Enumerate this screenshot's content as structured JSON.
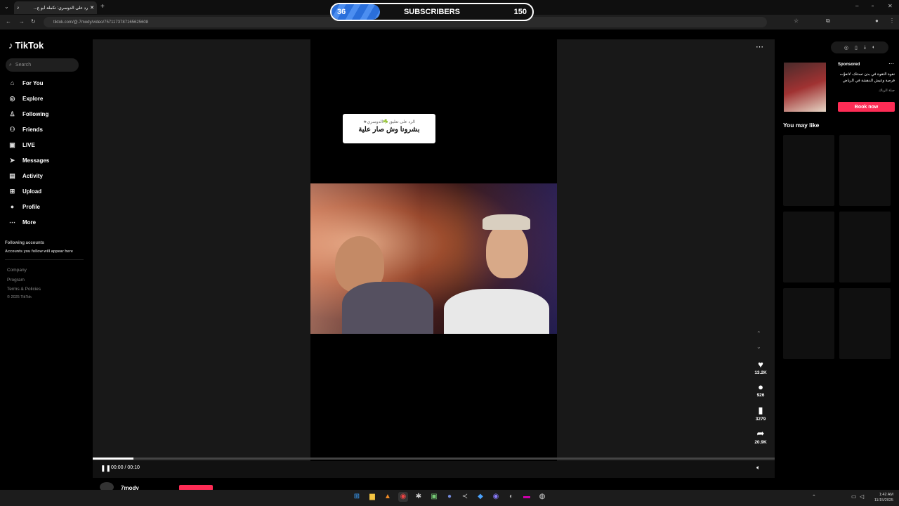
{
  "browser": {
    "tab_title": "رد على الدوسري: تكملة أبو ع...",
    "new_tab": "+",
    "url": "tiktok.com/@.7mody/video/7571173787165625608"
  },
  "subscribers_overlay": {
    "current": "36",
    "label": "SUBSCRIBERS",
    "goal": "150",
    "progress": 0.24,
    "fill_color": "#2a6fdb"
  },
  "sidebar": {
    "logo": "TikTok",
    "search_placeholder": "Search",
    "items": [
      {
        "label": "For You",
        "icon": "home-icon"
      },
      {
        "label": "Explore",
        "icon": "compass-icon"
      },
      {
        "label": "Following",
        "icon": "user-icon"
      },
      {
        "label": "Friends",
        "icon": "friends-icon"
      },
      {
        "label": "LIVE",
        "icon": "live-icon"
      },
      {
        "label": "Messages",
        "icon": "send-icon"
      },
      {
        "label": "Activity",
        "icon": "inbox-icon"
      },
      {
        "label": "Upload",
        "icon": "plus-icon"
      },
      {
        "label": "Profile",
        "icon": "avatar-icon"
      },
      {
        "label": "More",
        "icon": "more-icon"
      }
    ],
    "following_title": "Following accounts",
    "following_sub": "Accounts you follow will appear here",
    "footer": [
      "Company",
      "Program",
      "Terms & Policies",
      "© 2025 TikTok"
    ]
  },
  "video": {
    "caption_line1": "الرد على تعليق ☘️الدوسري★",
    "caption_line2": "بشرونا وش صار علية",
    "likes": "13.2K",
    "comments": "926",
    "saves": "3279",
    "shares": "20.9K",
    "time": "00:00 / 00:10",
    "progress": 0.06,
    "author": "7mody"
  },
  "right_panel": {
    "sponsored_label": "Sponsored",
    "ad_text": "نقوة التقوة في بدن تستثك، لاتفوّت فرصة وعيش الدهشة في الرياض",
    "ad_sub": "جبلة الرياك",
    "book_now": "Book now",
    "you_may_like": "You may like"
  },
  "taskbar": {
    "time": "1:42 AM",
    "date": "11/15/2025"
  },
  "colors": {
    "accent": "#fe2c55",
    "background": "#000000"
  }
}
